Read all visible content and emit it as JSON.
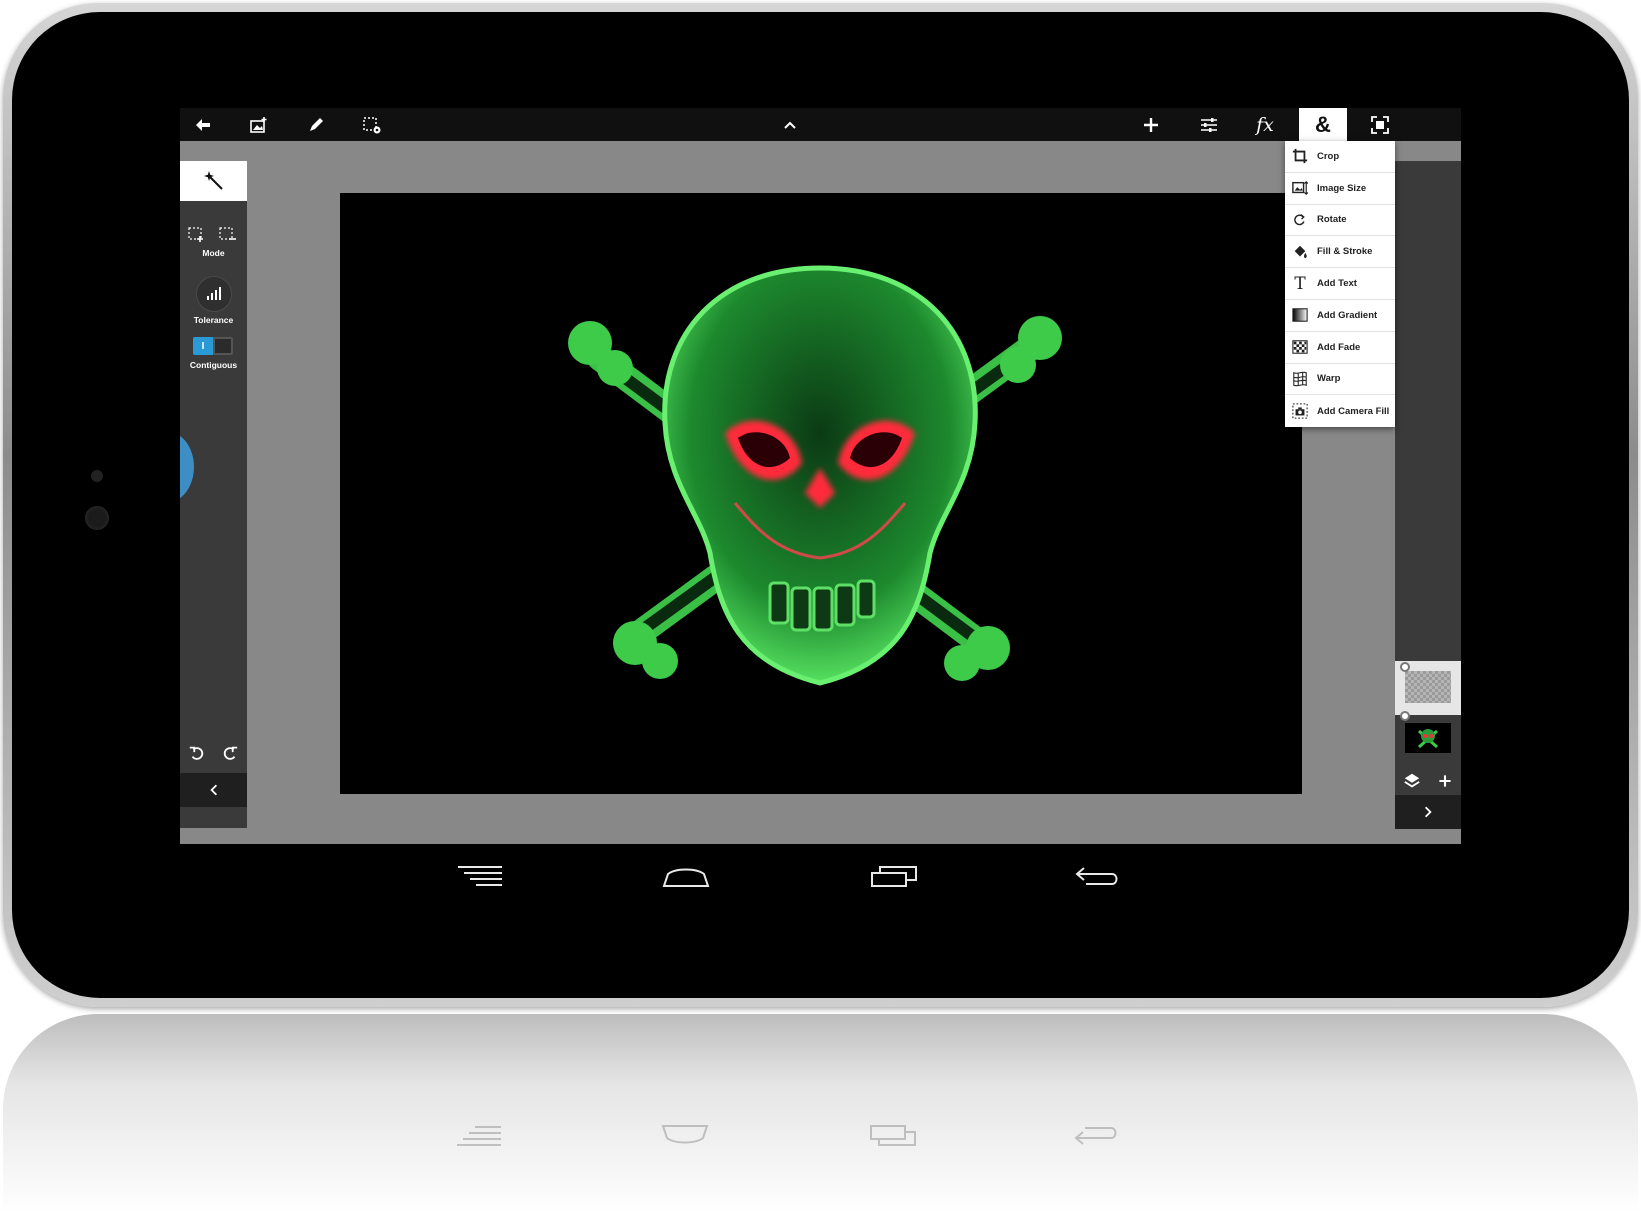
{
  "toolbar": {
    "left": [
      {
        "name": "back-icon"
      },
      {
        "name": "add-image-icon"
      },
      {
        "name": "brush-icon"
      },
      {
        "name": "selection-settings-icon"
      }
    ],
    "center": {
      "name": "chevron-up-icon"
    },
    "right": [
      {
        "name": "plus-icon"
      },
      {
        "name": "adjustments-icon"
      },
      {
        "name": "fx-icon",
        "label": "fx"
      },
      {
        "name": "ampersand-icon",
        "label": "&",
        "active": true
      },
      {
        "name": "fullscreen-icon"
      }
    ]
  },
  "left_panel": {
    "active_tool": "magic-wand-icon",
    "mode_label": "Mode",
    "tolerance_label": "Tolerance",
    "contiguous_label": "Contiguous",
    "contiguous_on": true,
    "toggle_text": "I"
  },
  "menu": {
    "items": [
      {
        "label": "Crop",
        "icon": "crop-icon"
      },
      {
        "label": "Image Size",
        "icon": "image-size-icon"
      },
      {
        "label": "Rotate",
        "icon": "rotate-icon"
      },
      {
        "label": "Fill & Stroke",
        "icon": "paint-bucket-icon"
      },
      {
        "label": "Add Text",
        "icon": "text-icon"
      },
      {
        "label": "Add Gradient",
        "icon": "gradient-icon"
      },
      {
        "label": "Add Fade",
        "icon": "fade-icon"
      },
      {
        "label": "Warp",
        "icon": "warp-icon"
      },
      {
        "label": "Add Camera Fill",
        "icon": "camera-fill-icon"
      }
    ]
  },
  "colors": {
    "accent": "#2a9ad6",
    "handle": "#3c8ec4",
    "artwork_green": "#3ecb4a",
    "artwork_red": "#ff2a3a"
  },
  "android_nav": [
    "recent-apps-menu-icon",
    "home-icon",
    "recents-icon",
    "back-arrow-icon"
  ]
}
